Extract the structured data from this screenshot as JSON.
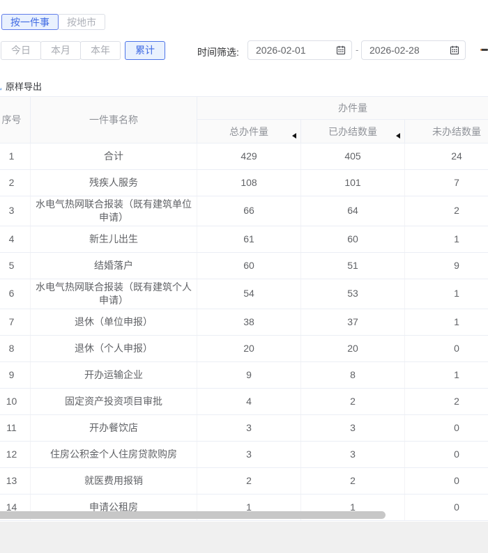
{
  "tabs": {
    "by_item": "按一件事",
    "by_city": "按地市"
  },
  "filters": {
    "today": "今日",
    "month": "本月",
    "year": "本年",
    "total": "累计",
    "time_label": "时间筛选:",
    "date_start": "2026-02-01",
    "date_end": "2026-02-28",
    "range_separator": "-"
  },
  "export": {
    "label": "原样导出"
  },
  "table": {
    "headers": {
      "index": "序号",
      "name": "一件事名称",
      "group": "办件量",
      "total": "总办件量",
      "done": "已办结数量",
      "undone": "未办结数量"
    },
    "rows": [
      {
        "index": "1",
        "name": "合计",
        "total": "429",
        "done": "405",
        "undone": "24"
      },
      {
        "index": "2",
        "name": "残疾人服务",
        "total": "108",
        "done": "101",
        "undone": "7"
      },
      {
        "index": "3",
        "name": "水电气热网联合报装（既有建筑单位申请）",
        "total": "66",
        "done": "64",
        "undone": "2"
      },
      {
        "index": "4",
        "name": "新生儿出生",
        "total": "61",
        "done": "60",
        "undone": "1"
      },
      {
        "index": "5",
        "name": "结婚落户",
        "total": "60",
        "done": "51",
        "undone": "9"
      },
      {
        "index": "6",
        "name": "水电气热网联合报装（既有建筑个人申请）",
        "total": "54",
        "done": "53",
        "undone": "1"
      },
      {
        "index": "7",
        "name": "退休（单位申报）",
        "total": "38",
        "done": "37",
        "undone": "1"
      },
      {
        "index": "8",
        "name": "退休（个人申报）",
        "total": "20",
        "done": "20",
        "undone": "0"
      },
      {
        "index": "9",
        "name": "开办运输企业",
        "total": "9",
        "done": "8",
        "undone": "1"
      },
      {
        "index": "10",
        "name": "固定资产投资项目审批",
        "total": "4",
        "done": "2",
        "undone": "2"
      },
      {
        "index": "11",
        "name": "开办餐饮店",
        "total": "3",
        "done": "3",
        "undone": "0"
      },
      {
        "index": "12",
        "name": "住房公积金个人住房贷款购房",
        "total": "3",
        "done": "3",
        "undone": "0"
      },
      {
        "index": "13",
        "name": "就医费用报销",
        "total": "2",
        "done": "2",
        "undone": "0"
      },
      {
        "index": "14",
        "name": "申请公租房",
        "total": "1",
        "done": "1",
        "undone": "0"
      }
    ]
  },
  "colors": {
    "accent_text": "#3f6ae3",
    "accent_border": "#5f7ce9",
    "accent_bg": "#e9f1fe",
    "header_text": "#909399",
    "body_text": "#606266",
    "border": "#ebeef5",
    "scrollbar_thumb": "#c7c7c7",
    "footer_band": "#f0f0f0"
  }
}
